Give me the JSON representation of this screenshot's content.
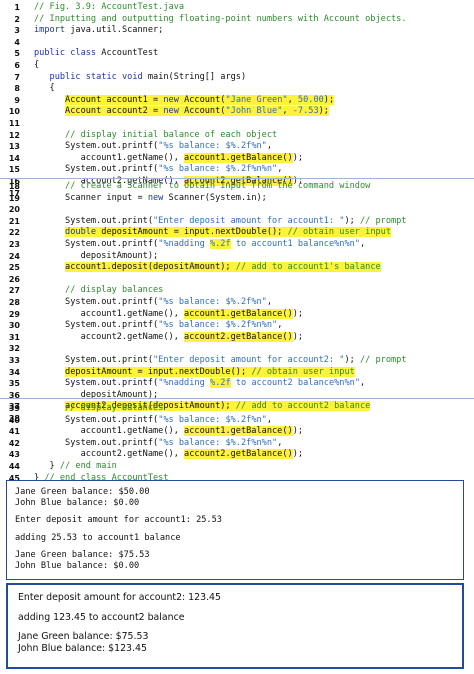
{
  "code_sections": [
    {
      "lines": [
        {
          "num": "1",
          "parts": [
            {
              "t": "// Fig. 3.9: AccountTest.java",
              "cls": "c"
            }
          ]
        },
        {
          "num": "2",
          "parts": [
            {
              "t": "// Inputting and outputting floating-point numbers with Account objects.",
              "cls": "c"
            }
          ]
        },
        {
          "num": "3",
          "parts": [
            {
              "t": "import",
              "cls": "k"
            },
            {
              "t": " java.util.Scanner;"
            }
          ]
        },
        {
          "num": "4",
          "parts": []
        },
        {
          "num": "5",
          "parts": [
            {
              "t": "public class",
              "cls": "k"
            },
            {
              "t": " AccountTest"
            }
          ]
        },
        {
          "num": "6",
          "parts": [
            {
              "t": "{"
            }
          ]
        },
        {
          "num": "7",
          "parts": [
            {
              "t": "   "
            },
            {
              "t": "public static void",
              "cls": "k"
            },
            {
              "t": " main(String[] args)"
            }
          ]
        },
        {
          "num": "8",
          "parts": [
            {
              "t": "   {"
            }
          ]
        },
        {
          "num": "9",
          "parts": [
            {
              "t": "      "
            },
            {
              "t": "Account account1 = ",
              "hl": true
            },
            {
              "t": "new",
              "cls": "k",
              "hl": true
            },
            {
              "t": " Account(",
              "hl": true
            },
            {
              "t": "\"Jane Green\"",
              "cls": "s",
              "hl": true
            },
            {
              "t": ", ",
              "hl": true
            },
            {
              "t": "50.00",
              "cls": "s",
              "hl": true
            },
            {
              "t": ");",
              "hl": true
            }
          ]
        },
        {
          "num": "10",
          "parts": [
            {
              "t": "      "
            },
            {
              "t": "Account account2 = ",
              "hl": true
            },
            {
              "t": "new",
              "cls": "k",
              "hl": true
            },
            {
              "t": " Account(",
              "hl": true
            },
            {
              "t": "\"John Blue\"",
              "cls": "s",
              "hl": true
            },
            {
              "t": ", ",
              "hl": true
            },
            {
              "t": "-7.53",
              "cls": "s",
              "hl": true
            },
            {
              "t": ");",
              "hl": true
            }
          ]
        },
        {
          "num": "11",
          "parts": []
        },
        {
          "num": "12",
          "parts": [
            {
              "t": "      "
            },
            {
              "t": "// display initial balance of each object",
              "cls": "c"
            }
          ]
        },
        {
          "num": "13",
          "parts": [
            {
              "t": "      System.out.printf("
            },
            {
              "t": "\"%s balance: $%.2f%n\"",
              "cls": "s"
            },
            {
              "t": ","
            }
          ]
        },
        {
          "num": "14",
          "parts": [
            {
              "t": "         account1.getName(), "
            },
            {
              "t": "account1.getBalance()",
              "hl": true
            },
            {
              "t": ");"
            }
          ]
        },
        {
          "num": "15",
          "parts": [
            {
              "t": "      System.out.printf("
            },
            {
              "t": "\"%s balance: $%.2f%n%n\"",
              "cls": "s"
            },
            {
              "t": ","
            }
          ]
        },
        {
          "num": "16",
          "parts": [
            {
              "t": "         account2.getName(), "
            },
            {
              "t": "account2.getBalance()",
              "hl": true
            },
            {
              "t": ");"
            }
          ]
        },
        {
          "num": "17",
          "parts": []
        }
      ]
    },
    {
      "lines": [
        {
          "num": "18",
          "parts": [
            {
              "t": "      "
            },
            {
              "t": "// create a Scanner to obtain input from the command window",
              "cls": "c"
            }
          ]
        },
        {
          "num": "19",
          "parts": [
            {
              "t": "      Scanner input = "
            },
            {
              "t": "new",
              "cls": "k"
            },
            {
              "t": " Scanner(System.in);"
            }
          ]
        },
        {
          "num": "20",
          "parts": []
        },
        {
          "num": "21",
          "parts": [
            {
              "t": "      System.out.print("
            },
            {
              "t": "\"Enter deposit amount for account1: \"",
              "cls": "s"
            },
            {
              "t": "); "
            },
            {
              "t": "// prompt",
              "cls": "c"
            }
          ]
        },
        {
          "num": "22",
          "parts": [
            {
              "t": "      "
            },
            {
              "t": "double",
              "cls": "k",
              "hl": true
            },
            {
              "t": " depositAmount = input.nextDouble(); ",
              "hl": true
            },
            {
              "t": "// obtain user input",
              "cls": "c",
              "hl": true
            }
          ]
        },
        {
          "num": "23",
          "parts": [
            {
              "t": "      System.out.printf("
            },
            {
              "t": "\"%nadding ",
              "cls": "s"
            },
            {
              "t": "%.2f",
              "cls": "s",
              "hl": true
            },
            {
              "t": " to account1 balance%n%n\"",
              "cls": "s"
            },
            {
              "t": ","
            }
          ]
        },
        {
          "num": "24",
          "parts": [
            {
              "t": "         depositAmount);"
            }
          ]
        },
        {
          "num": "25",
          "parts": [
            {
              "t": "      "
            },
            {
              "t": "account1.deposit(depositAmount); ",
              "hl": true
            },
            {
              "t": "// add to account1's balance",
              "cls": "c",
              "hl": true
            }
          ]
        },
        {
          "num": "26",
          "parts": []
        },
        {
          "num": "27",
          "parts": [
            {
              "t": "      "
            },
            {
              "t": "// display balances",
              "cls": "c"
            }
          ]
        },
        {
          "num": "28",
          "parts": [
            {
              "t": "      System.out.printf("
            },
            {
              "t": "\"%s balance: $%.2f%n\"",
              "cls": "s"
            },
            {
              "t": ","
            }
          ]
        },
        {
          "num": "29",
          "parts": [
            {
              "t": "         account1.getName(), "
            },
            {
              "t": "account1.getBalance()",
              "hl": true
            },
            {
              "t": ");"
            }
          ]
        },
        {
          "num": "30",
          "parts": [
            {
              "t": "      System.out.printf("
            },
            {
              "t": "\"%s balance: $%.2f%n%n\"",
              "cls": "s"
            },
            {
              "t": ","
            }
          ]
        },
        {
          "num": "31",
          "parts": [
            {
              "t": "         account2.getName(), "
            },
            {
              "t": "account2.getBalance()",
              "hl": true
            },
            {
              "t": ");"
            }
          ]
        },
        {
          "num": "32",
          "parts": []
        },
        {
          "num": "33",
          "parts": [
            {
              "t": "      System.out.print("
            },
            {
              "t": "\"Enter deposit amount for account2: \"",
              "cls": "s"
            },
            {
              "t": "); "
            },
            {
              "t": "// prompt",
              "cls": "c"
            }
          ]
        },
        {
          "num": "34",
          "parts": [
            {
              "t": "      "
            },
            {
              "t": "depositAmount = input.nextDouble(); ",
              "hl": true
            },
            {
              "t": "// obtain user input",
              "cls": "c",
              "hl": true
            }
          ]
        },
        {
          "num": "35",
          "parts": [
            {
              "t": "      System.out.printf("
            },
            {
              "t": "\"%nadding ",
              "cls": "s"
            },
            {
              "t": "%.2f",
              "cls": "s",
              "hl": true
            },
            {
              "t": " to account2 balance%n%n\"",
              "cls": "s"
            },
            {
              "t": ","
            }
          ]
        },
        {
          "num": "36",
          "parts": [
            {
              "t": "         depositAmount);"
            }
          ]
        },
        {
          "num": "37",
          "parts": [
            {
              "t": "      "
            },
            {
              "t": "account2.deposit(depositAmount); ",
              "hl": true
            },
            {
              "t": "// add to account2 balance",
              "cls": "c",
              "hl": true
            }
          ]
        },
        {
          "num": "38",
          "parts": []
        }
      ]
    },
    {
      "lines": [
        {
          "num": "39",
          "parts": [
            {
              "t": "      "
            },
            {
              "t": "// display balances",
              "cls": "c"
            }
          ]
        },
        {
          "num": "40",
          "parts": [
            {
              "t": "      System.out.printf("
            },
            {
              "t": "\"%s balance: $%.2f%n\"",
              "cls": "s"
            },
            {
              "t": ","
            }
          ]
        },
        {
          "num": "41",
          "parts": [
            {
              "t": "         account1.getName(), "
            },
            {
              "t": "account1.getBalance()",
              "hl": true
            },
            {
              "t": ");"
            }
          ]
        },
        {
          "num": "42",
          "parts": [
            {
              "t": "      System.out.printf("
            },
            {
              "t": "\"%s balance: $%.2f%n%n\"",
              "cls": "s"
            },
            {
              "t": ","
            }
          ]
        },
        {
          "num": "43",
          "parts": [
            {
              "t": "         account2.getName(), "
            },
            {
              "t": "account2.getBalance()",
              "hl": true
            },
            {
              "t": ");"
            }
          ]
        },
        {
          "num": "44",
          "parts": [
            {
              "t": "   } "
            },
            {
              "t": "// end main",
              "cls": "c"
            }
          ]
        },
        {
          "num": "45",
          "parts": [
            {
              "t": "} "
            },
            {
              "t": "// end class AccountTest",
              "cls": "c"
            }
          ]
        }
      ]
    }
  ],
  "output1": [
    "Jane Green balance: $50.00",
    "John Blue balance: $0.00",
    "",
    "Enter deposit amount for account1: 25.53",
    "",
    "adding 25.53 to account1 balance",
    "",
    "Jane Green balance: $75.53",
    "John Blue balance: $0.00"
  ],
  "output2": [
    "Enter deposit amount for account2: 123.45",
    "",
    "adding 123.45 to account2 balance",
    "",
    "Jane Green balance: $75.53",
    "John Blue balance: $123.45"
  ]
}
